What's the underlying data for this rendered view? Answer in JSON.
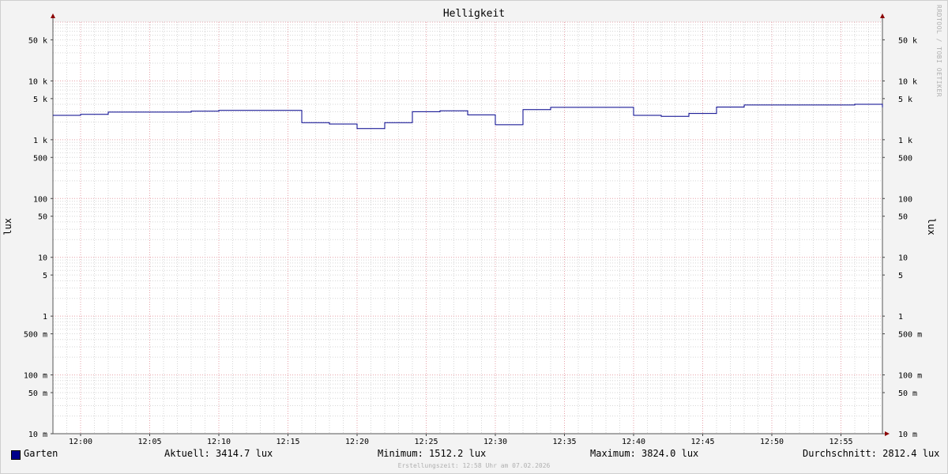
{
  "chart_data": {
    "type": "line",
    "title": "Helligkeit",
    "ylabel": "lux",
    "y_scale": "log",
    "ylim": [
      0.01,
      100000
    ],
    "y_ticks": [
      {
        "v": 50000,
        "label": "50 k"
      },
      {
        "v": 10000,
        "label": "10 k"
      },
      {
        "v": 5000,
        "label": "5 k"
      },
      {
        "v": 1000,
        "label": "1 k"
      },
      {
        "v": 500,
        "label": "500"
      },
      {
        "v": 100,
        "label": "100"
      },
      {
        "v": 50,
        "label": "50"
      },
      {
        "v": 10,
        "label": "10"
      },
      {
        "v": 5,
        "label": "5"
      },
      {
        "v": 1,
        "label": "1"
      },
      {
        "v": 0.5,
        "label": "500 m"
      },
      {
        "v": 0.1,
        "label": "100 m"
      },
      {
        "v": 0.05,
        "label": "50 m"
      },
      {
        "v": 0.01,
        "label": "10 m"
      }
    ],
    "xlim": [
      "11:58",
      "12:58"
    ],
    "x_ticks": [
      "12:00",
      "12:05",
      "12:10",
      "12:15",
      "12:20",
      "12:25",
      "12:30",
      "12:35",
      "12:40",
      "12:45",
      "12:50",
      "12:55"
    ],
    "grid": true,
    "series": [
      {
        "name": "Garten",
        "color": "#00008b",
        "step": true,
        "points": [
          {
            "t": "11:58",
            "v": 2600
          },
          {
            "t": "12:00",
            "v": 2700
          },
          {
            "t": "12:02",
            "v": 2950
          },
          {
            "t": "12:08",
            "v": 3050
          },
          {
            "t": "12:10",
            "v": 3150
          },
          {
            "t": "12:16",
            "v": 1950
          },
          {
            "t": "12:18",
            "v": 1850
          },
          {
            "t": "12:20",
            "v": 1550
          },
          {
            "t": "12:22",
            "v": 1950
          },
          {
            "t": "12:24",
            "v": 3000
          },
          {
            "t": "12:26",
            "v": 3100
          },
          {
            "t": "12:28",
            "v": 2650
          },
          {
            "t": "12:30",
            "v": 1800
          },
          {
            "t": "12:32",
            "v": 3250
          },
          {
            "t": "12:34",
            "v": 3550
          },
          {
            "t": "12:40",
            "v": 2600
          },
          {
            "t": "12:42",
            "v": 2500
          },
          {
            "t": "12:44",
            "v": 2800
          },
          {
            "t": "12:46",
            "v": 3600
          },
          {
            "t": "12:48",
            "v": 3900
          },
          {
            "t": "12:56",
            "v": 4000
          },
          {
            "t": "12:58",
            "v": 3550
          }
        ]
      }
    ]
  },
  "legend": {
    "series_name": "Garten",
    "current": "Aktuell: 3414.7 lux",
    "minimum": "Minimum: 1512.2 lux",
    "maximum": "Maximum: 3824.0 lux",
    "average": "Durchschnitt: 2812.4 lux"
  },
  "watermark": "RRDTOOL / TOBI OETIKER",
  "created": "Erstellungszeit: 12:58 Uhr am 07.02.2026"
}
